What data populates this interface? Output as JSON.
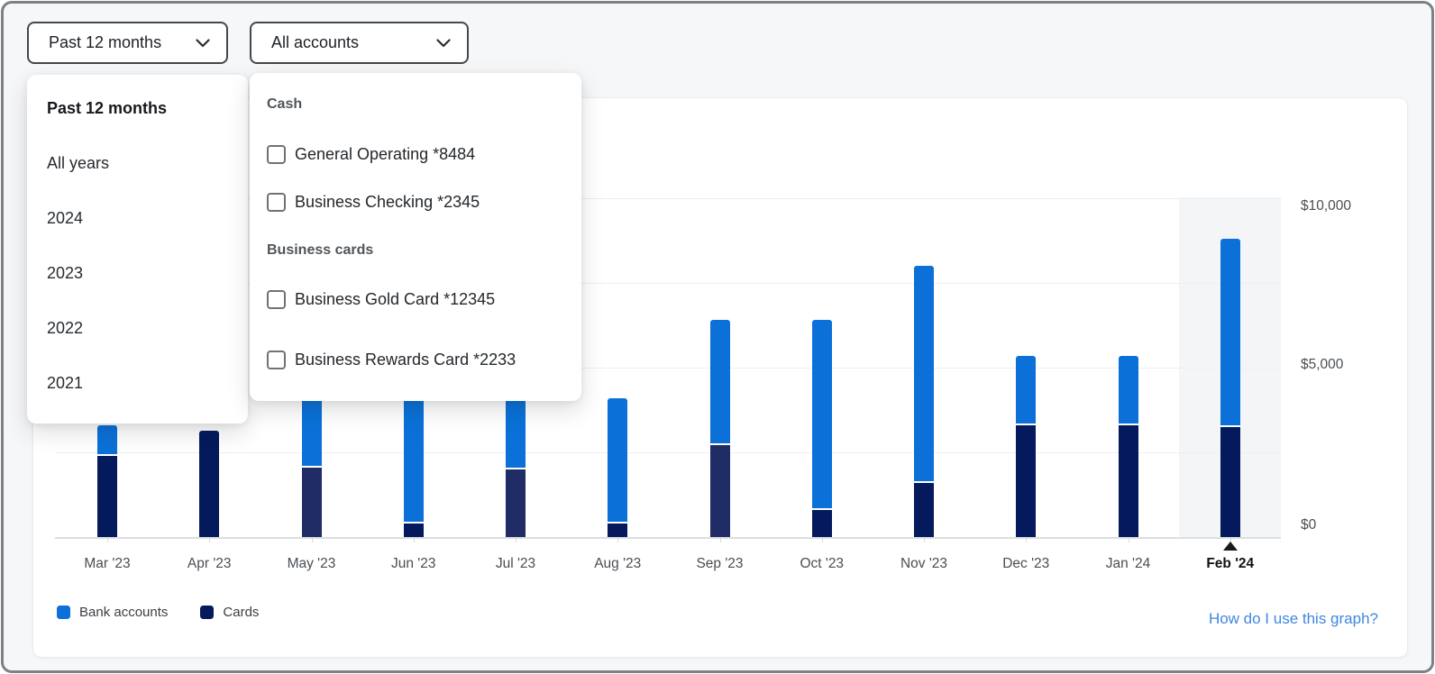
{
  "filters": {
    "period_button": {
      "label": "Past 12 months",
      "icon": "chevron-down"
    },
    "accounts_button": {
      "label": "All accounts",
      "icon": "chevron-down"
    }
  },
  "period_menu": {
    "items": [
      {
        "label": "Past 12 months",
        "selected": true
      },
      {
        "label": "All years",
        "selected": false
      },
      {
        "label": "2024",
        "selected": false
      },
      {
        "label": "2023",
        "selected": false
      },
      {
        "label": "2022",
        "selected": false
      },
      {
        "label": "2021",
        "selected": false
      }
    ]
  },
  "accounts_menu": {
    "sections": [
      {
        "header": "Cash",
        "options": [
          {
            "label": "General Operating *8484",
            "checked": false
          },
          {
            "label": "Business Checking *2345",
            "checked": false
          }
        ]
      },
      {
        "header": "Business cards",
        "options": [
          {
            "label": "Business Gold Card *12345",
            "checked": false
          },
          {
            "label": "Business Rewards Card *2233",
            "checked": false
          }
        ]
      }
    ]
  },
  "chart_data": {
    "type": "bar",
    "stacked": true,
    "categories": [
      "Mar '23",
      "Apr '23",
      "May '23",
      "Jun '23",
      "Jul '23",
      "Aug '23",
      "Sep '23",
      "Oct '23",
      "Nov '23",
      "Dec '23",
      "Jan '24",
      "Feb '24"
    ],
    "series": [
      {
        "name": "Bank accounts",
        "color": "#0b71d8",
        "values": [
          900,
          0,
          2050,
          3700,
          2100,
          3700,
          3700,
          5600,
          6400,
          2050,
          2050,
          5550
        ]
      },
      {
        "name": "Cards",
        "color": "#041a5c",
        "muted_color": "#1f2c66",
        "muted_indexes": [
          2,
          4,
          6
        ],
        "values": [
          2400,
          3150,
          2050,
          400,
          2000,
          400,
          2700,
          800,
          1600,
          3300,
          3300,
          3250
        ]
      }
    ],
    "ylim": [
      0,
      10000
    ],
    "y_ticks": [
      {
        "label": "$10,000",
        "value": 10000
      },
      {
        "label": "$5,000",
        "value": 5000
      },
      {
        "label": "$0",
        "value": 0
      }
    ],
    "gridline_values": [
      10000,
      7500,
      5000,
      2500
    ],
    "highlighted_category": "Feb '24",
    "legend_position": "bottom-left",
    "grid": true,
    "help_link": "How do I use this graph?"
  }
}
